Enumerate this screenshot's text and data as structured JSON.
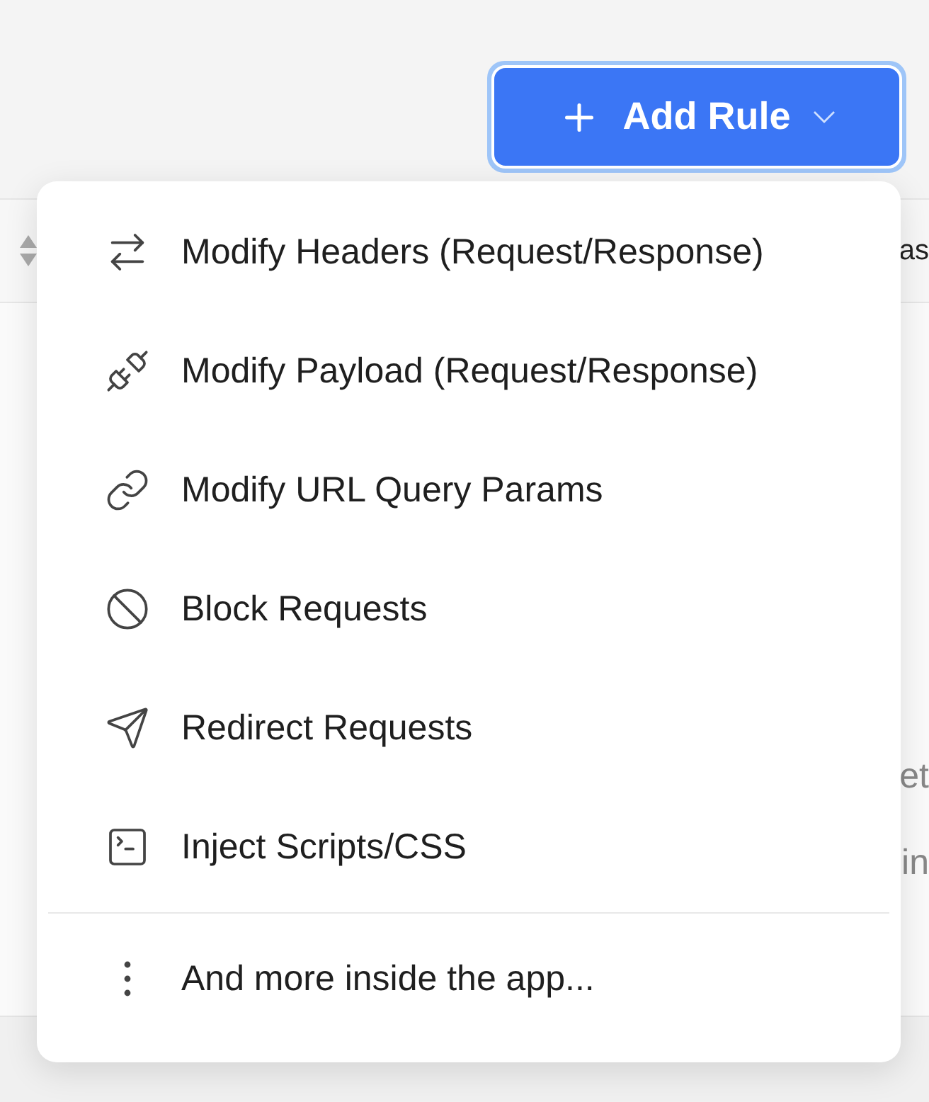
{
  "add_rule_button": {
    "label": "Add Rule"
  },
  "background": {
    "header_text": "as",
    "body_lines": [
      "et",
      "in"
    ]
  },
  "menu": {
    "items": [
      {
        "kind": "headers",
        "label": "Modify Headers (Request/Response)"
      },
      {
        "kind": "payload",
        "label": "Modify Payload (Request/Response)"
      },
      {
        "kind": "query",
        "label": "Modify URL Query Params"
      },
      {
        "kind": "block",
        "label": "Block Requests"
      },
      {
        "kind": "redirect",
        "label": "Redirect Requests"
      },
      {
        "kind": "inject",
        "label": "Inject Scripts/CSS"
      },
      {
        "kind": "more",
        "label": "And more inside the app..."
      }
    ]
  }
}
